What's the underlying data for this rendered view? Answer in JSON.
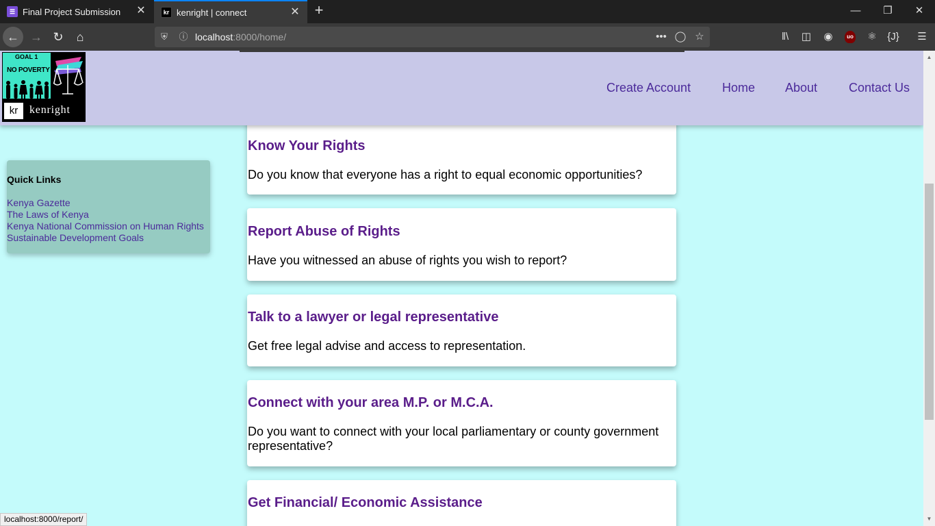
{
  "browser": {
    "tabs": [
      {
        "title": "Final Project Submission",
        "favicon": "list-icon"
      },
      {
        "title": "kenright | connect",
        "favicon": "kr"
      }
    ],
    "url_host": "localhost",
    "url_rest": ":8000/home/",
    "status_url": "localhost:8000/report/"
  },
  "site": {
    "logo": {
      "goal": "GOAL 1",
      "goal_title": "NO POVERTY",
      "mark": "kr",
      "name": "kenright"
    },
    "nav": [
      "Create Account",
      "Home",
      "About",
      "Contact Us"
    ]
  },
  "quick_links": {
    "title": "Quick Links",
    "links": [
      "Kenya Gazette",
      "The Laws of Kenya",
      "Kenya National Commission on Human Rights",
      "Sustainable Development Goals"
    ]
  },
  "cards": [
    {
      "title": "Know Your Rights",
      "text": "Do you know that everyone has a right to equal economic opportunities?"
    },
    {
      "title": "Report Abuse of Rights",
      "text": "Have you witnessed an abuse of rights you wish to report?"
    },
    {
      "title": "Talk to a lawyer or legal representative",
      "text": "Get free legal advise and access to representation."
    },
    {
      "title": "Connect with your area M.P. or M.C.A.",
      "text": "Do you want to connect with your local parliamentary or county government representative?"
    },
    {
      "title": "Get Financial/ Economic Assistance",
      "text": ""
    }
  ],
  "colors": {
    "page_bg": "#c4fbfb",
    "header_bg": "#c8c8e8",
    "link": "#4b2a9a",
    "card_title": "#5a1d8a",
    "quicklinks_bg": "#96cbc2"
  }
}
